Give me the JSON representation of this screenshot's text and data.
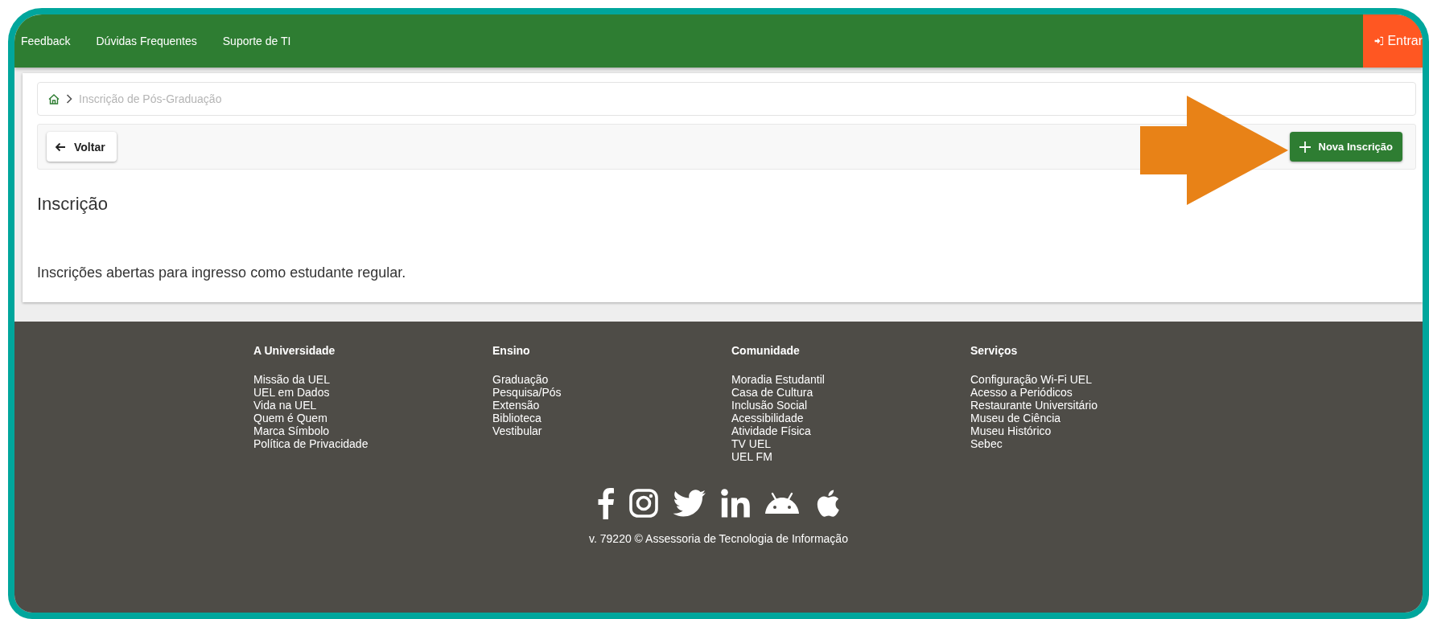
{
  "header": {
    "nav_links": [
      "Feedback",
      "Dúvidas Frequentes",
      "Suporte de TI"
    ],
    "login_button": "Entrar"
  },
  "breadcrumb": {
    "items": [
      "Inscrição de Pós-Graduação"
    ]
  },
  "toolbar": {
    "back_button": "Voltar",
    "new_button": "Nova Inscrição"
  },
  "page_title": "Inscrição",
  "message": "Inscrições abertas para ingresso como estudante regular.",
  "footer": {
    "columns": [
      {
        "heading": "A Universidade",
        "links": [
          "Missão da UEL",
          "UEL em Dados",
          "Vida na UEL",
          "Quem é Quem",
          "Marca Símbolo",
          "Política de Privacidade"
        ]
      },
      {
        "heading": "Ensino",
        "links": [
          "Graduação",
          "Pesquisa/Pós",
          "Extensão",
          "Biblioteca",
          "Vestibular"
        ]
      },
      {
        "heading": "Comunidade",
        "links": [
          "Moradia Estudantil",
          "Casa de Cultura",
          "Inclusão Social",
          "Acessibilidade",
          "Atividade Física",
          "TV UEL",
          "UEL FM"
        ]
      },
      {
        "heading": "Serviços",
        "links": [
          "Configuração Wi-Fi UEL",
          "Acesso a Periódicos",
          "Restaurante Universitário",
          "Museu de Ciência",
          "Museu Histórico",
          "Sebec"
        ]
      }
    ],
    "version": "v. 79220 © Assessoria de Tecnologia de Informação"
  }
}
